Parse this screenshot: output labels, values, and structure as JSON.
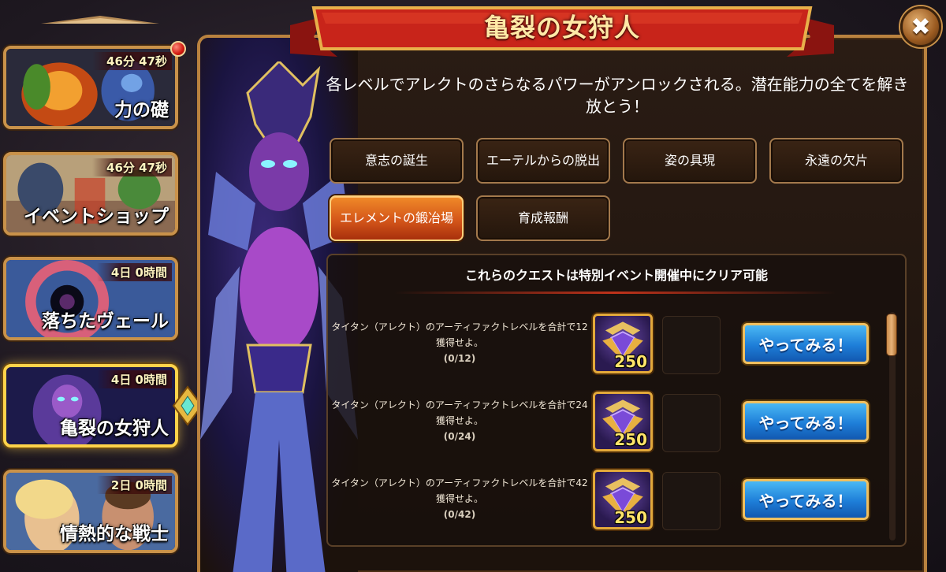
{
  "title": "亀裂の女狩人",
  "description": "各レベルでアレクトのさらなるパワーがアンロックされる。潜在能力の全てを解き放とう！",
  "sidebar": {
    "events": [
      {
        "label": "力の礎",
        "timer": "46分 47秒",
        "notification": true
      },
      {
        "label": "イベントショップ",
        "timer": "46分 47秒",
        "notification": false
      },
      {
        "label": "落ちたヴェール",
        "timer": "4日 0時間",
        "notification": false
      },
      {
        "label": "亀裂の女狩人",
        "timer": "4日 0時間",
        "notification": false,
        "active": true
      },
      {
        "label": "情熱的な戦士",
        "timer": "2日 0時間",
        "notification": false
      }
    ]
  },
  "tabs": [
    {
      "label": "意志の誕生",
      "active": false
    },
    {
      "label": "エーテルからの脱出",
      "active": false
    },
    {
      "label": "姿の具現",
      "active": false
    },
    {
      "label": "永遠の欠片",
      "active": false
    },
    {
      "label": "エレメントの鍛冶場",
      "active": true
    },
    {
      "label": "育成報酬",
      "active": false
    }
  ],
  "quests": {
    "header": "これらのクエストは特別イベント開催中にクリア可能",
    "items": [
      {
        "text": "タイタン（アレクト）のアーティファクトレベルを合計で12獲得せよ。",
        "progress": "(0/12)",
        "reward": "250",
        "button": "やってみる！"
      },
      {
        "text": "タイタン（アレクト）のアーティファクトレベルを合計で24獲得せよ。",
        "progress": "(0/24)",
        "reward": "250",
        "button": "やってみる！"
      },
      {
        "text": "タイタン（アレクト）のアーティファクトレベルを合計で42獲得せよ。",
        "progress": "(0/42)",
        "reward": "250",
        "button": "やってみる！"
      }
    ]
  },
  "icons": {
    "close": "close-icon",
    "reward": "titan-artifact-essence-icon",
    "pointer": "active-event-pointer-icon"
  },
  "colors": {
    "frame_gold": "#c9924a",
    "title_ribbon": "#c8241a",
    "active_tab": "#e06a20",
    "go_button": "#2a8ee0",
    "reward_amount": "#ffe46a"
  }
}
